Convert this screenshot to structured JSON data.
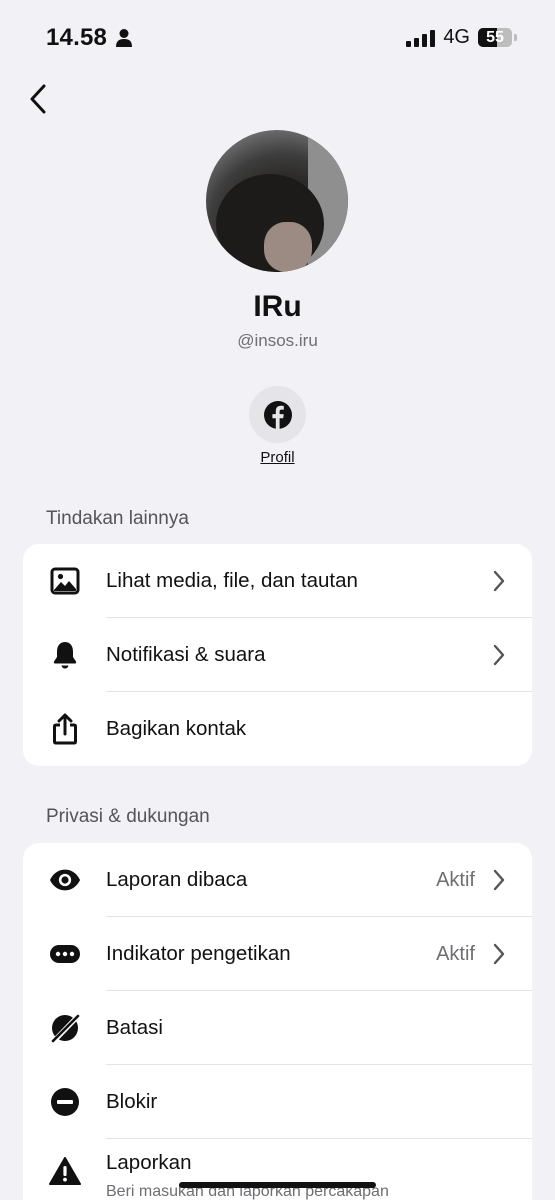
{
  "status_bar": {
    "time": "14.58",
    "network": "4G",
    "battery_percent": "55",
    "battery_level": 0.55
  },
  "profile": {
    "name": "IRu",
    "handle": "@insos.iru",
    "facebook_label": "Profil"
  },
  "sections": {
    "more_actions": {
      "title": "Tindakan lainnya",
      "items": [
        {
          "label": "Lihat media, file, dan tautan",
          "icon": "image-icon"
        },
        {
          "label": "Notifikasi & suara",
          "icon": "bell-icon"
        },
        {
          "label": "Bagikan kontak",
          "icon": "share-icon"
        }
      ]
    },
    "privacy": {
      "title": "Privasi & dukungan",
      "items": [
        {
          "label": "Laporan dibaca",
          "value": "Aktif",
          "icon": "eye-icon"
        },
        {
          "label": "Indikator pengetikan",
          "value": "Aktif",
          "icon": "typing-bubble-icon"
        },
        {
          "label": "Batasi",
          "icon": "restrict-icon"
        },
        {
          "label": "Blokir",
          "icon": "block-icon"
        },
        {
          "label": "Laporkan",
          "sublabel": "Beri masukan dan laporkan percakapan",
          "icon": "warning-icon"
        }
      ]
    }
  }
}
